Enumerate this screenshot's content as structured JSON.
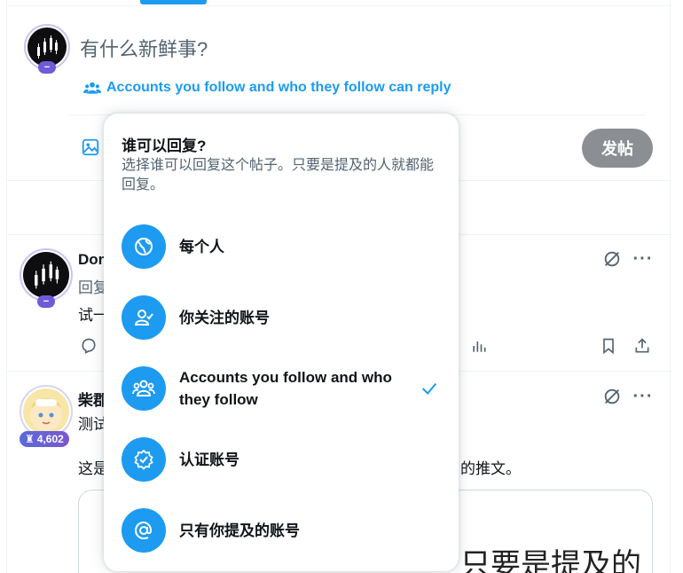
{
  "composer": {
    "placeholder": "有什么新鲜事?",
    "reply_setting": "Accounts you follow and who they follow can reply",
    "post_button": "发帖",
    "avatar_badge": "−"
  },
  "reply_popup": {
    "title": "谁可以回复?",
    "description": "选择谁可以回复这个帖子。只要是提及的人就都能回复。",
    "options": [
      {
        "label": "每个人",
        "icon": "globe-icon",
        "selected": false
      },
      {
        "label": "你关注的账号",
        "icon": "person-check-icon",
        "selected": false
      },
      {
        "label": "Accounts you follow and who they follow",
        "icon": "people-group-icon",
        "selected": true
      },
      {
        "label": "认证账号",
        "icon": "verified-badge-icon",
        "selected": false
      },
      {
        "label": "只有你提及的账号",
        "icon": "at-sign-icon",
        "selected": false
      }
    ]
  },
  "timeline": {
    "tweets": [
      {
        "name_visible": "Dor",
        "sub_visible": "回复",
        "body_visible": "试一",
        "avatar_badge": "−"
      },
      {
        "name_visible": "柴郡",
        "sub_visible": "测试",
        "body_visible_left": "这是",
        "body_visible_right": "的推文。",
        "rank_badge": "4,602",
        "card_text_visible": "只要是提及的"
      }
    ]
  },
  "colors": {
    "accent": "#1d9bf0",
    "post_button_disabled": "#8b8f93",
    "secondary_text": "#536471",
    "badge_purple": "#6f5bd8"
  }
}
